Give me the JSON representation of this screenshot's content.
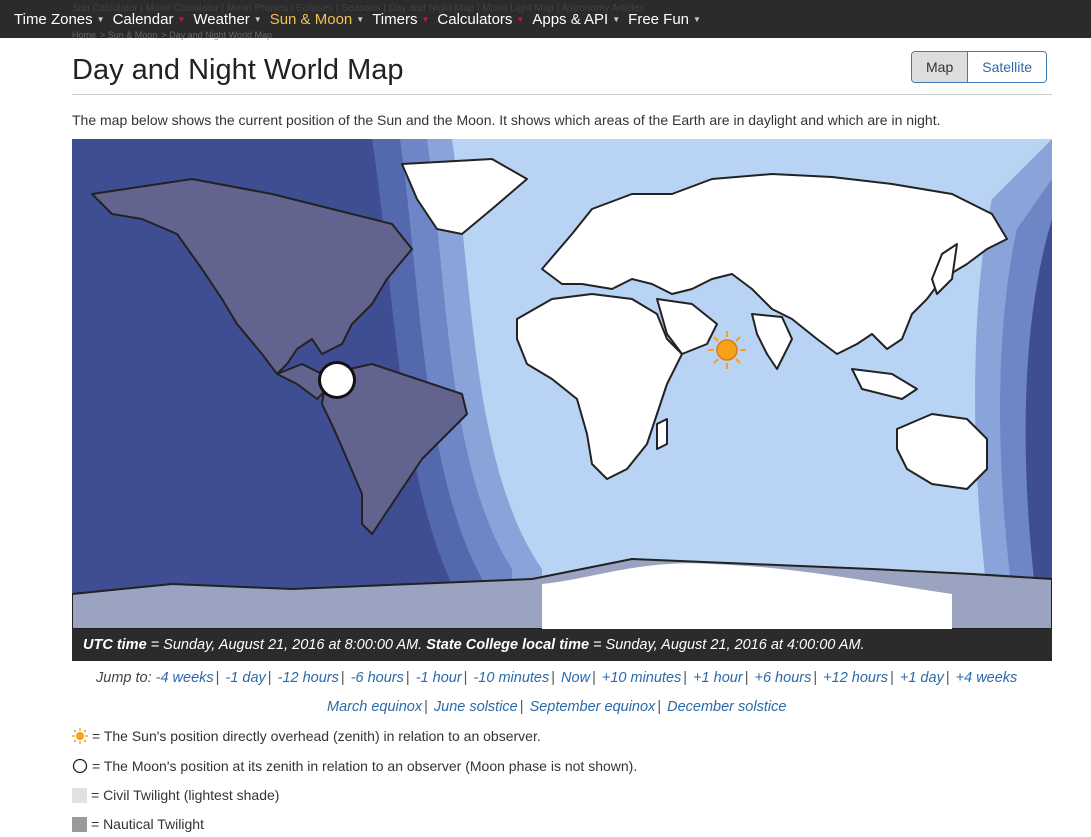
{
  "nav": {
    "items": [
      {
        "label": "Time Zones",
        "active": false
      },
      {
        "label": "Calendar",
        "active": false
      },
      {
        "label": "Weather",
        "active": false
      },
      {
        "label": "Sun & Moon",
        "active": true
      },
      {
        "label": "Timers",
        "active": false
      },
      {
        "label": "Calculators",
        "active": false
      },
      {
        "label": "Apps & API",
        "active": false
      },
      {
        "label": "Free Fun",
        "active": false
      }
    ],
    "subnav": "Sun Calculator | Moon Calculator | Moon Phases | Eclipses | Seasons | Day and Night Map | Moon Light Map | Astronomy Articles"
  },
  "breadcrumb": [
    "Home",
    "Sun & Moon",
    "Day and Night World Map"
  ],
  "page": {
    "title": "Day and Night World Map",
    "intro": "The map below shows the current position of the Sun and the Moon. It shows which areas of the Earth are in daylight and which are in night."
  },
  "view_toggle": {
    "map": "Map",
    "satellite": "Satellite",
    "selected": "Map"
  },
  "timebar": {
    "utc_label": "UTC time",
    "utc_value": " = Sunday, August 21, 2016 at 8:00:00 AM. ",
    "local_label": "State College local time",
    "local_value": " = Sunday, August 21, 2016 at 4:00:00 AM."
  },
  "jump": {
    "label": "Jump to:",
    "links": [
      "-4 weeks",
      "-1 day",
      "-12 hours",
      "-6 hours",
      "-1 hour",
      "-10 minutes",
      "Now",
      "+10 minutes",
      "+1 hour",
      "+6 hours",
      "+12 hours",
      "+1 day",
      "+4 weeks"
    ],
    "equinox_links": [
      "March equinox",
      "June solstice",
      "September equinox",
      "December solstice"
    ]
  },
  "legend": {
    "sun": "= The Sun's position directly overhead (zenith) in relation to an observer.",
    "moon": "= The Moon's position at its zenith in relation to an observer (Moon phase is not shown).",
    "civil": "= Civil Twilight (lightest shade)",
    "nautical": "= Nautical Twilight"
  },
  "colors": {
    "ocean_day": "#b9d3f5",
    "land_day": "#ffffff",
    "twilight_civil": "#8aa3d8",
    "twilight_nautical": "#6e85c6",
    "twilight_astro": "#5468ad",
    "night": "#3f4e92",
    "sun": "#f7a11a",
    "link": "#2a6aa8"
  }
}
